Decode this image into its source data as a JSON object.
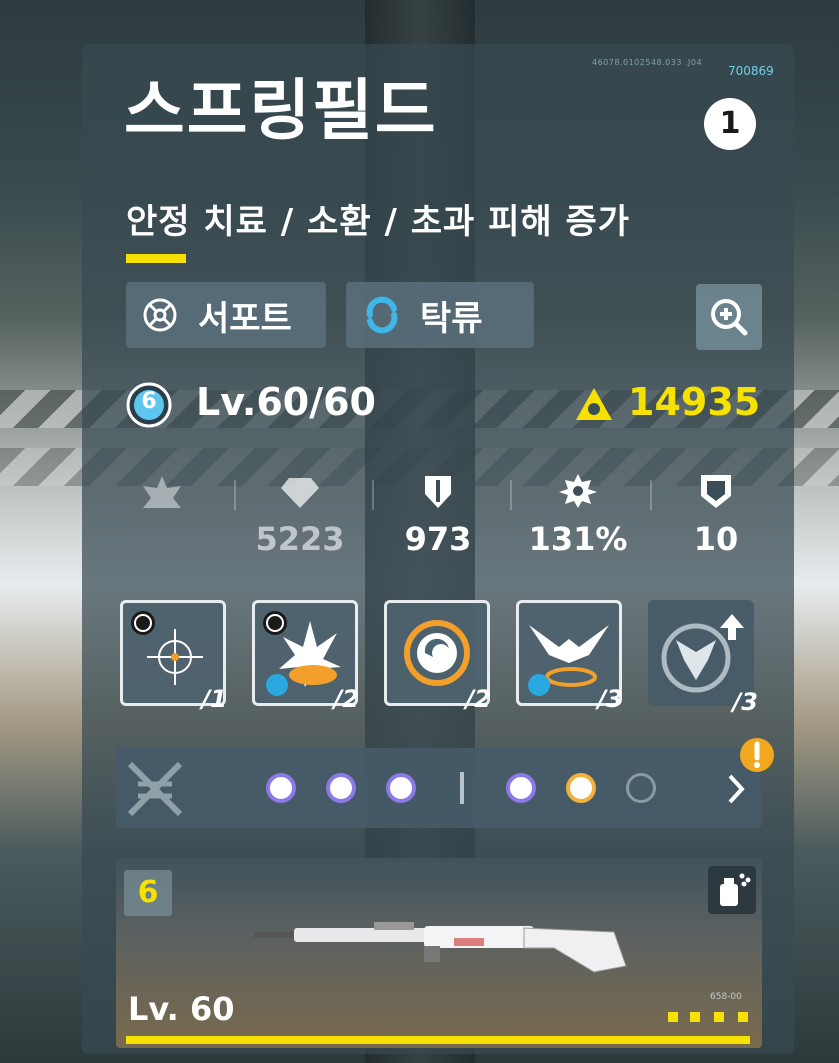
{
  "serial": "46078.0102548.033 .J04",
  "code_top": "700869",
  "character": {
    "name": "스프링필드",
    "rank": "1",
    "subtitle": "안정 치료 / 소환 / 초과 피해 증가",
    "role_tag": "서포트",
    "element_tag": "탁류",
    "level": "Lv.60/60",
    "level_badge": "6",
    "power": "14935"
  },
  "stats": [
    {
      "icon": "flower-icon",
      "value": ""
    },
    {
      "icon": "heart-icon",
      "value": "5223"
    },
    {
      "icon": "shield-icon",
      "value": "973"
    },
    {
      "icon": "gear-icon",
      "value": "131%"
    },
    {
      "icon": "badge-icon",
      "value": "10"
    }
  ],
  "skills": [
    {
      "name": "crosshair-skill",
      "count": "/1"
    },
    {
      "name": "explosion-skill",
      "count": "/2"
    },
    {
      "name": "swirl-skill",
      "count": "/2"
    },
    {
      "name": "eagle-skill",
      "count": "/3"
    },
    {
      "name": "upgrade-skill",
      "count": "/3"
    }
  ],
  "neural_dots": [
    {
      "state": "active",
      "ring": "#8b79e6"
    },
    {
      "state": "active",
      "ring": "#8b79e6"
    },
    {
      "state": "active",
      "ring": "#8b79e6"
    },
    {
      "state": "active",
      "ring": "#8b79e6"
    },
    {
      "state": "active",
      "ring": "#f2b03d"
    },
    {
      "state": "empty",
      "ring": "#8a9aa2"
    }
  ],
  "weapon": {
    "slot": "6",
    "level": "Lv. 60",
    "code": "658-00",
    "stars": 4
  },
  "colors": {
    "accent": "#f7e100",
    "alert": "#f0a81e"
  }
}
